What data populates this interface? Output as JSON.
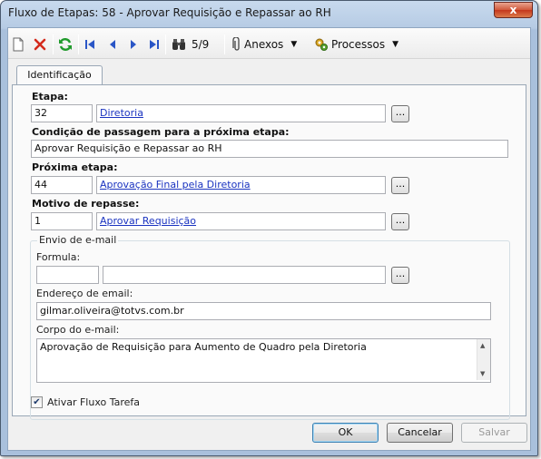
{
  "window": {
    "title": "Fluxo de Etapas: 58 - Aprovar Requisição e Repassar ao RH",
    "close_label": "x"
  },
  "toolbar": {
    "counter": "5/9",
    "attachments_label": "Anexos",
    "processes_label": "Processos"
  },
  "tabs": [
    {
      "label": "Identificação"
    }
  ],
  "form": {
    "etapa_label": "Etapa:",
    "etapa_code": "32",
    "etapa_name": "Diretoria",
    "condicao_label": "Condição de passagem para a próxima etapa:",
    "condicao_value": "Aprovar Requisição e Repassar ao RH",
    "proxima_label": "Próxima etapa:",
    "proxima_code": "44",
    "proxima_name": "Aprovação Final pela Diretoria",
    "motivo_label": "Motivo de repasse:",
    "motivo_code": "1",
    "motivo_name": "Aprovar Requisição",
    "browse_label": "..."
  },
  "email": {
    "group_title": "Envio de e-mail",
    "formula_label": "Formula:",
    "formula_code": "",
    "formula_name": "",
    "address_label": "Endereço de email:",
    "address_value": "gilmar.oliveira@totvs.com.br",
    "body_label": "Corpo do e-mail:",
    "body_value": "Aprovação de Requisição para Aumento de Quadro pela Diretoria"
  },
  "checkbox": {
    "label": "Ativar Fluxo Tarefa",
    "checked": true
  },
  "buttons": {
    "ok": "OK",
    "cancel": "Cancelar",
    "save": "Salvar"
  },
  "colors": {
    "link": "#1a33c0",
    "titlebar": "#b6cbe4",
    "close": "#c4371c"
  }
}
